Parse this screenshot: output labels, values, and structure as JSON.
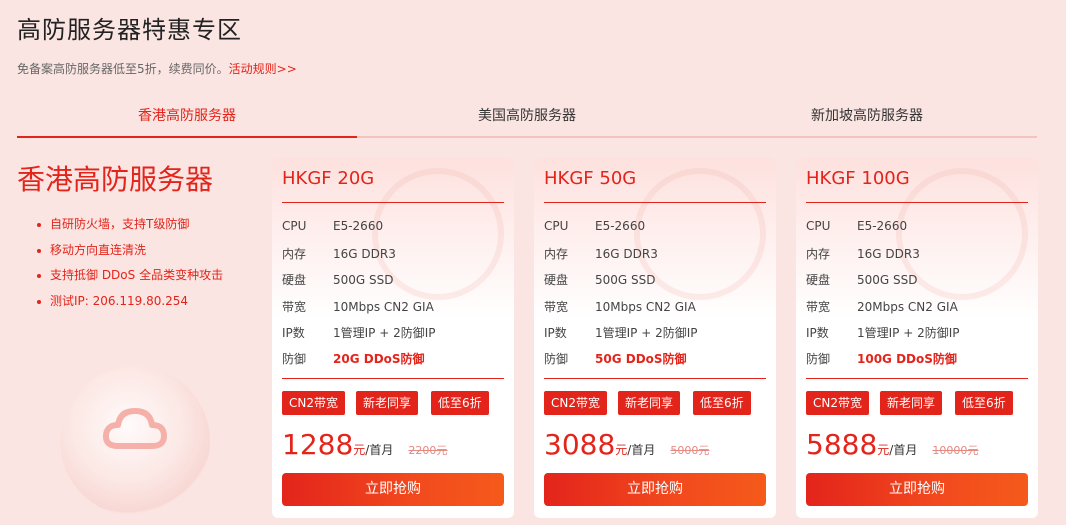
{
  "header": {
    "title": "高防服务器特惠专区",
    "subtitle_text": "免备案高防服务器低至5折，续费同价。",
    "subtitle_link": "活动规则>>"
  },
  "tabs": [
    {
      "label": "香港高防服务器",
      "active": true
    },
    {
      "label": "美国高防服务器",
      "active": false
    },
    {
      "label": "新加坡高防服务器",
      "active": false
    }
  ],
  "left": {
    "title": "香港高防服务器",
    "features": [
      "自研防火墙，支持T级防御",
      "移动方向直连清洗",
      "支持抵御 DDoS 全品类变种攻击",
      "测试IP: 206.119.80.254"
    ]
  },
  "spec_labels": [
    "CPU",
    "内存",
    "硬盘",
    "带宽",
    "IP数",
    "防御"
  ],
  "cards": [
    {
      "title": "HKGF 20G",
      "specs": [
        "E5-2660",
        "16G DDR3",
        "500G SSD",
        "10Mbps CN2 GIA",
        "1管理IP + 2防御IP",
        "20G DDoS防御"
      ],
      "tags": [
        "CN2带宽",
        "新老同享",
        "低至6折"
      ],
      "price": "1288",
      "price_unit": "元",
      "price_period": "/首月",
      "old_price": "2200元",
      "button": "立即抢购"
    },
    {
      "title": "HKGF 50G",
      "specs": [
        "E5-2660",
        "16G DDR3",
        "500G SSD",
        "10Mbps CN2 GIA",
        "1管理IP + 2防御IP",
        "50G DDoS防御"
      ],
      "tags": [
        "CN2带宽",
        "新老同享",
        "低至6折"
      ],
      "price": "3088",
      "price_unit": "元",
      "price_period": "/首月",
      "old_price": "5000元",
      "button": "立即抢购"
    },
    {
      "title": "HKGF 100G",
      "specs": [
        "E5-2660",
        "16G DDR3",
        "500G SSD",
        "20Mbps CN2 GIA",
        "1管理IP + 2防御IP",
        "100G DDoS防御"
      ],
      "tags": [
        "CN2带宽",
        "新老同享",
        "低至6折"
      ],
      "price": "5888",
      "price_unit": "元",
      "price_period": "/首月",
      "old_price": "10000元",
      "button": "立即抢购"
    }
  ],
  "colors": {
    "accent": "#e3241b",
    "background": "#fbe5e2"
  }
}
